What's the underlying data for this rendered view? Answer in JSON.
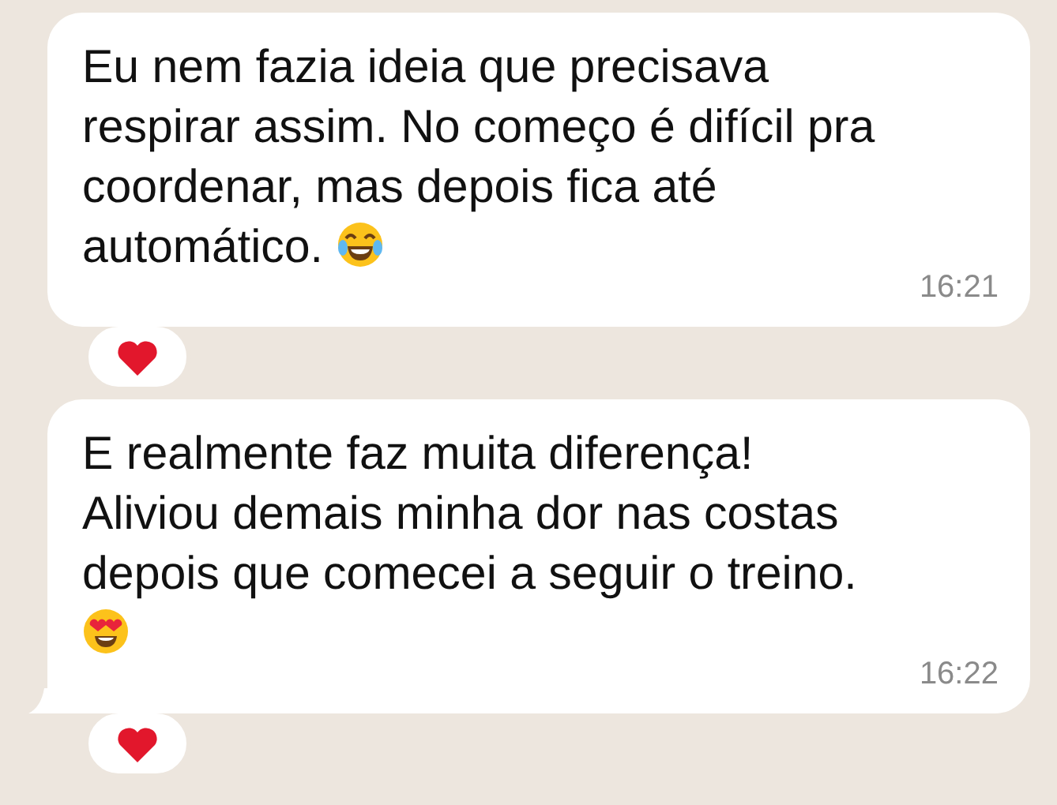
{
  "messages": [
    {
      "text": "Eu nem fazia ideia que precisava respirar assim. No começo é difícil pra coordenar, mas depois fica até automático.",
      "emoji": {
        "kind": "laughing"
      },
      "time": "16:21",
      "tail": false,
      "reaction": {
        "kind": "heart"
      }
    },
    {
      "text": "E realmente faz muita diferença! Aliviou demais minha dor nas costas depois que comecei a seguir o treino.",
      "emoji": {
        "kind": "heart-eyes"
      },
      "time": "16:22",
      "tail": true,
      "reaction": {
        "kind": "heart"
      }
    }
  ]
}
